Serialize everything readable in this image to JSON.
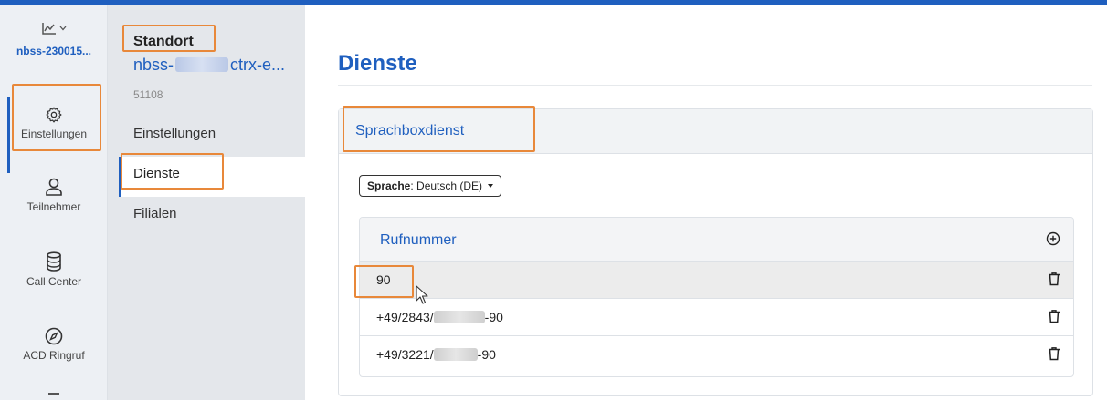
{
  "rail": {
    "org_name": "nbss-230015...",
    "items": [
      {
        "label": "Einstellungen",
        "icon": "gear-icon",
        "active": true
      },
      {
        "label": "Teilnehmer",
        "icon": "user-icon"
      },
      {
        "label": "Call Center",
        "icon": "database-icon"
      },
      {
        "label": "ACD Ringruf",
        "icon": "compass-icon"
      }
    ]
  },
  "subnav": {
    "section_label": "Standort",
    "site_name_prefix": "nbss-",
    "site_name_suffix": "ctrx-e...",
    "site_number": "51108",
    "items": [
      "Einstellungen",
      "Dienste",
      "Filialen"
    ],
    "active": "Dienste"
  },
  "main": {
    "title": "Dienste",
    "service_card": {
      "title": "Sprachboxdienst",
      "language_label": "Sprache",
      "language_value": ": Deutsch (DE)",
      "table": {
        "header": "Rufnummer",
        "rows": [
          {
            "prefix": "90",
            "suffix": ""
          },
          {
            "prefix": "+49/2843/",
            "suffix": "-90"
          },
          {
            "prefix": "+49/3221/",
            "suffix": "-90"
          }
        ]
      }
    }
  },
  "colors": {
    "accent": "#1f5fbf",
    "highlight": "#e8883a"
  }
}
